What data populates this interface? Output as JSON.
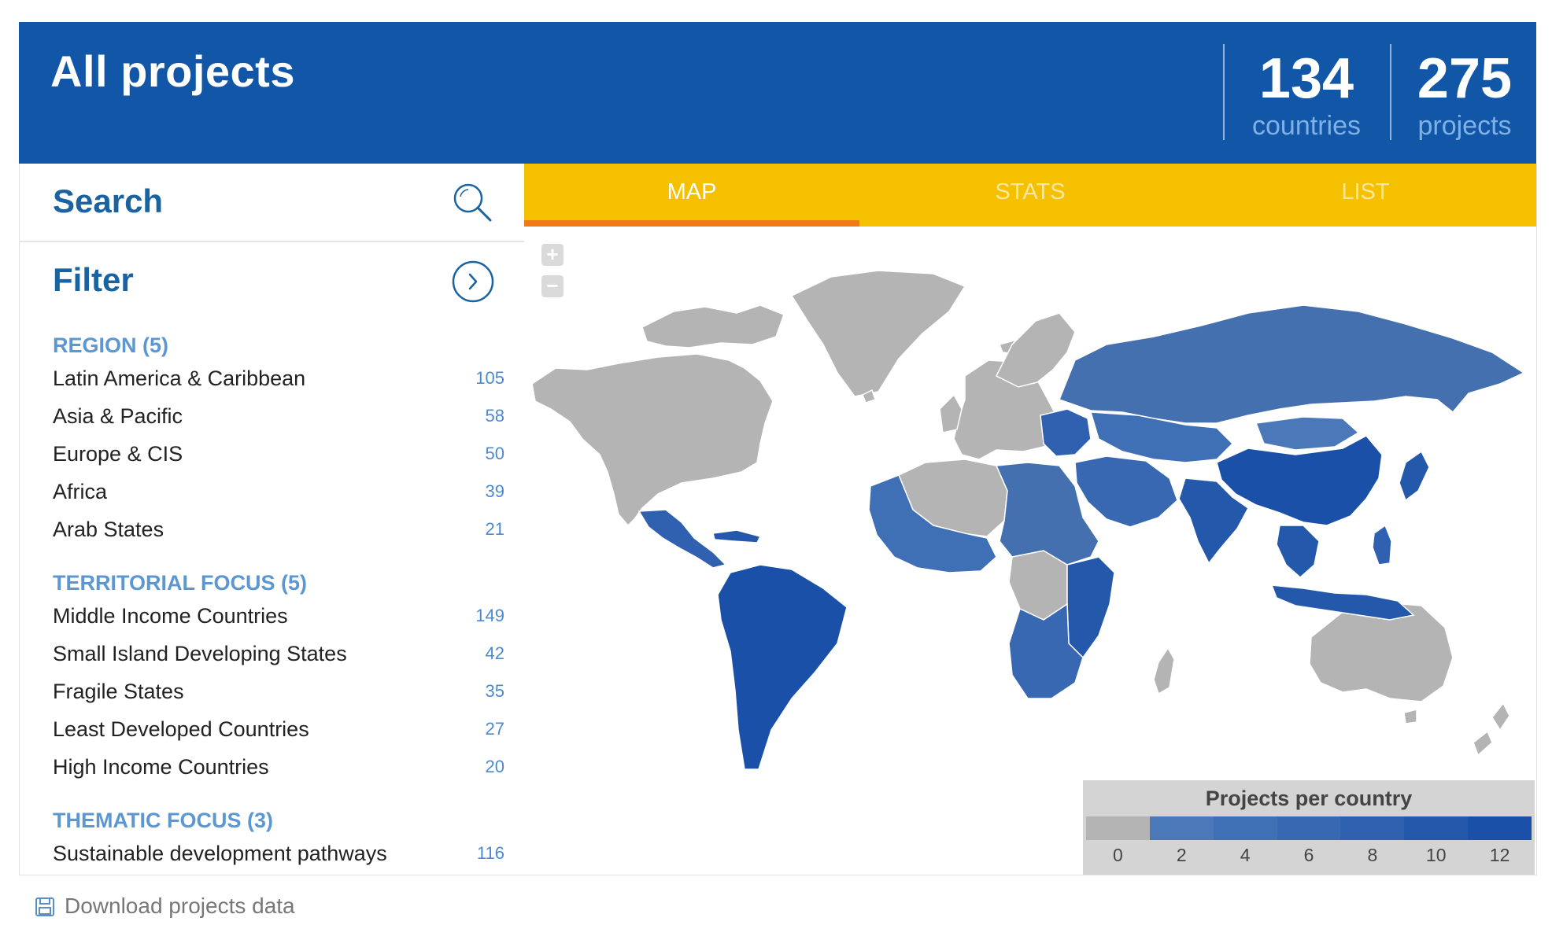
{
  "header": {
    "title": "All projects",
    "countries_count": "134",
    "countries_label": "countries",
    "projects_count": "275",
    "projects_label": "projects"
  },
  "sidebar": {
    "search_label": "Search",
    "filter_label": "Filter",
    "sections": [
      {
        "title": "REGION (5)",
        "items": [
          {
            "label": "Latin America & Caribbean",
            "count": "105"
          },
          {
            "label": "Asia & Pacific",
            "count": "58"
          },
          {
            "label": "Europe & CIS",
            "count": "50"
          },
          {
            "label": "Africa",
            "count": "39"
          },
          {
            "label": "Arab States",
            "count": "21"
          }
        ]
      },
      {
        "title": "TERRITORIAL FOCUS (5)",
        "items": [
          {
            "label": "Middle Income Countries",
            "count": "149"
          },
          {
            "label": "Small Island Developing States",
            "count": "42"
          },
          {
            "label": "Fragile States",
            "count": "35"
          },
          {
            "label": "Least Developed Countries",
            "count": "27"
          },
          {
            "label": "High Income Countries",
            "count": "20"
          }
        ]
      },
      {
        "title": "THEMATIC FOCUS (3)",
        "items": [
          {
            "label": "Sustainable development pathways",
            "count": "116"
          }
        ]
      }
    ]
  },
  "tabs": [
    {
      "label": "MAP",
      "active": true
    },
    {
      "label": "STATS",
      "active": false
    },
    {
      "label": "LIST",
      "active": false
    }
  ],
  "map": {
    "zoom_in": "+",
    "zoom_out": "−",
    "legend": {
      "title": "Projects per country",
      "ticks": [
        "0",
        "2",
        "4",
        "6",
        "8",
        "10",
        "12"
      ],
      "colors": [
        "#b4b4b4",
        "#4a78b8",
        "#3f70b6",
        "#3868b2",
        "#2f61b0",
        "#2458ab",
        "#1b50a8"
      ]
    }
  },
  "footer": {
    "download_label": "Download projects data"
  }
}
